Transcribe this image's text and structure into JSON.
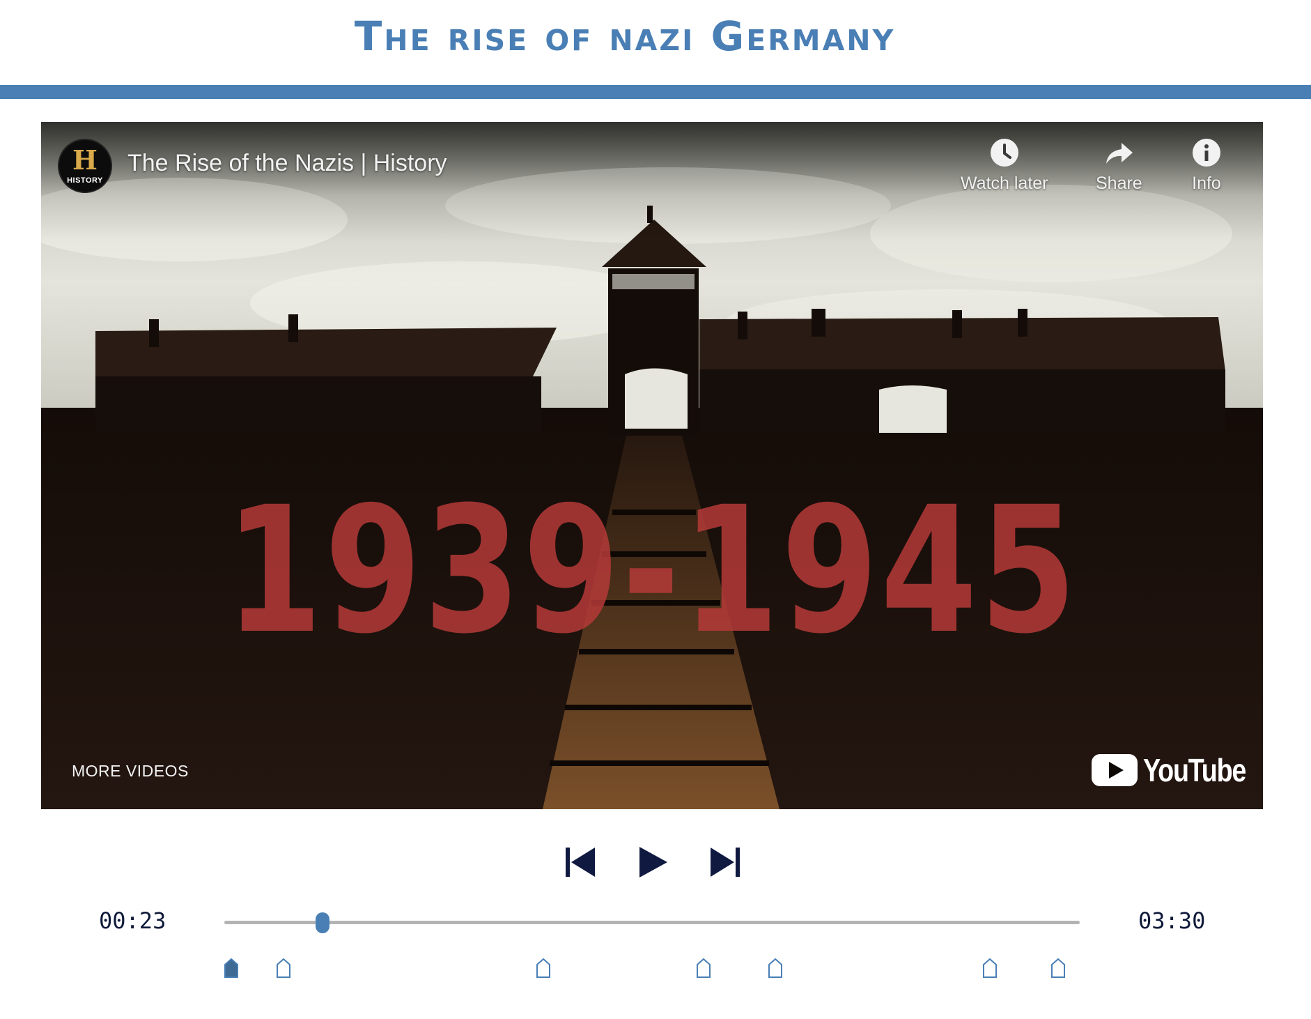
{
  "page": {
    "title": "The rise of nazi Germany"
  },
  "video": {
    "title": "The Rise of the Nazis | History",
    "channel_logo_letter": "H",
    "channel_logo_word": "HISTORY",
    "overlay_text": "1939-1945",
    "actions": [
      {
        "label": "Watch later",
        "icon": "clock-icon"
      },
      {
        "label": "Share",
        "icon": "share-arrow-icon"
      },
      {
        "label": "Info",
        "icon": "info-icon"
      }
    ],
    "more_videos_label": "MORE VIDEOS",
    "youtube_logo_text": "YouTube"
  },
  "player": {
    "current_time": "00:23",
    "duration": "03:30",
    "progress_fraction": 0.115,
    "accent_color": "#4a7fb5",
    "controls": [
      "previous-icon",
      "play-icon",
      "next-icon"
    ],
    "chapter_markers": [
      {
        "fraction": 0.008,
        "active": true
      },
      {
        "fraction": 0.069,
        "active": false
      },
      {
        "fraction": 0.373,
        "active": false
      },
      {
        "fraction": 0.56,
        "active": false
      },
      {
        "fraction": 0.644,
        "active": false
      },
      {
        "fraction": 0.895,
        "active": false
      },
      {
        "fraction": 0.975,
        "active": false
      }
    ]
  }
}
